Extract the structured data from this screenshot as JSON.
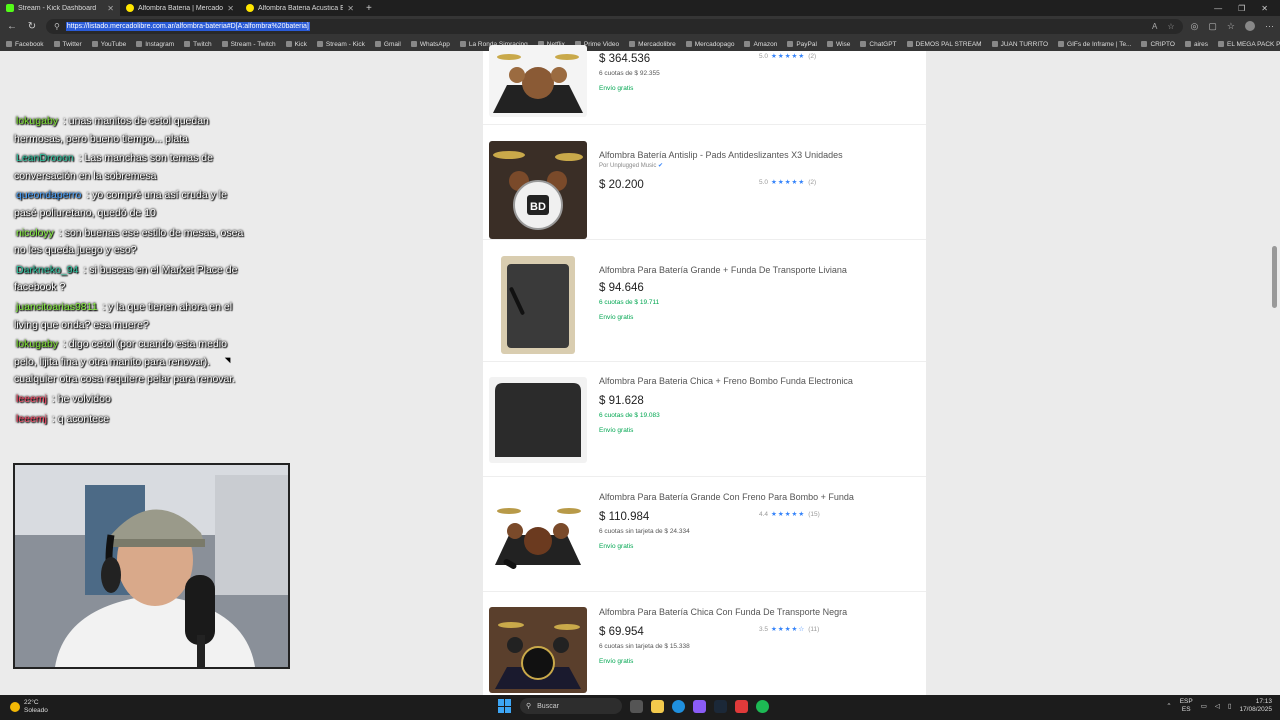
{
  "tabs": [
    {
      "title": "Stream - Kick Dashboard",
      "favicon": "kick-icon",
      "active": true
    },
    {
      "title": "Alfombra Bateria | MercadoLibre",
      "favicon": "mercadolibre-icon",
      "active": false
    },
    {
      "title": "Alfombra Bateria Acustica Electr...",
      "favicon": "mercadolibre-icon",
      "active": false
    }
  ],
  "address": {
    "url": "https://listado.mercadolibre.com.ar/alfombra-bateria#D[A:alfombra%20bateria]"
  },
  "bookmarks": [
    "Facebook",
    "Twitter",
    "YouTube",
    "Instagram",
    "Twitch",
    "Stream - Twitch",
    "Kick",
    "Stream - Kick",
    "Gmail",
    "WhatsApp",
    "La Ronda Simracing",
    "Netflix",
    "Prime Video",
    "Mercadolibre",
    "Mercadopago",
    "Amazon",
    "PayPal",
    "Wise",
    "ChatGPT",
    "DEMOS PAL STREAM",
    "JUAN TURRITO",
    "GIFs de Inframe | Te...",
    "CRIPTO",
    "aires",
    "EL MEGA PACK PAP..."
  ],
  "results": [
    {
      "title": "",
      "seller": "",
      "price": "$ 364.536",
      "cuotas": "6 cuotas de $ 92.355",
      "cuotas_green": false,
      "envio": "Envío gratis",
      "rating": "5.0",
      "stars": "★★★★★",
      "reviews": "(2)"
    },
    {
      "title": "Alfombra Batería Antislip - Pads Antideslizantes X3 Unidades",
      "seller": "Por Unplugged Music",
      "price": "$ 20.200",
      "cuotas": "",
      "cuotas_green": false,
      "envio": "",
      "rating": "5.0",
      "stars": "★★★★★",
      "reviews": "(2)"
    },
    {
      "title": "Alfombra Para Batería Grande + Funda De Transporte Liviana",
      "seller": "",
      "price": "$ 94.646",
      "cuotas": "6 cuotas de $ 19.711",
      "cuotas_green": true,
      "envio": "Envío gratis",
      "rating": "",
      "stars": "",
      "reviews": ""
    },
    {
      "title": "Alfombra Para Bateria Chica + Freno Bombo Funda Electronica",
      "seller": "",
      "price": "$ 91.628",
      "cuotas": "6 cuotas de $ 19.083",
      "cuotas_green": true,
      "envio": "Envío gratis",
      "rating": "",
      "stars": "",
      "reviews": ""
    },
    {
      "title": "Alfombra Para Batería Grande Con Freno Para Bombo + Funda",
      "seller": "",
      "price": "$ 110.984",
      "cuotas": "6 cuotas sin tarjeta de $ 24.334",
      "cuotas_green": false,
      "envio": "Envío gratis",
      "rating": "4.4",
      "stars": "★★★★★",
      "reviews": "(15)"
    },
    {
      "title": "Alfombra Para Batería Chica Con Funda De Transporte Negra",
      "seller": "",
      "price": "$ 69.954",
      "cuotas": "6 cuotas sin tarjeta de $ 15.338",
      "cuotas_green": false,
      "envio": "Envío gratis",
      "rating": "3.5",
      "stars": "★★★★☆",
      "reviews": "(11)"
    }
  ],
  "chat": [
    {
      "user": "lokugaby",
      "text": ": unas manitos de cetol quedan hermosas, pero bueno tiempo... plata",
      "color": "u-green"
    },
    {
      "user": "LeanDrooon",
      "text": ": Las manchas son temas de conversación en la sobremesa",
      "color": "u-teal"
    },
    {
      "user": "queondaperro",
      "text": ": yo compré una así cruda y le pasé poliuretano, quedó de 10",
      "color": "u-blue"
    },
    {
      "user": "nicoloyy",
      "text": ": son buenas ese estilo de mesas, osea no les queda juego y eso?",
      "color": "u-lime"
    },
    {
      "user": "Darkneko_94",
      "text": ": si buscas en el Market Place de facebook ?",
      "color": "u-teal"
    },
    {
      "user": "juancitoarias9811",
      "text": ": y la que tienen ahora en el living que onda? esa muere?",
      "color": "u-lime"
    },
    {
      "user": "lokugaby",
      "text": ": digo cetol (por cuando esta medio pelo, lijita fina y otra manito para renovar). cualquier otra cosa requiere pelar para renovar.",
      "color": "u-green"
    },
    {
      "user": "leeemj",
      "text": ": he volvidoo",
      "color": "u-red"
    },
    {
      "user": "leeemj",
      "text": ": q acontece",
      "color": "u-red"
    }
  ],
  "taskbar": {
    "temp": "22°C",
    "weather": "Soleado",
    "search": "Buscar",
    "lang1": "ESP",
    "lang2": "ES",
    "time": "17:13",
    "date": "17/08/2025"
  },
  "colors": {
    "accent_blue": "#3483fa",
    "free_shipping": "#00a650",
    "url_highlight": "#2a5bd7"
  }
}
